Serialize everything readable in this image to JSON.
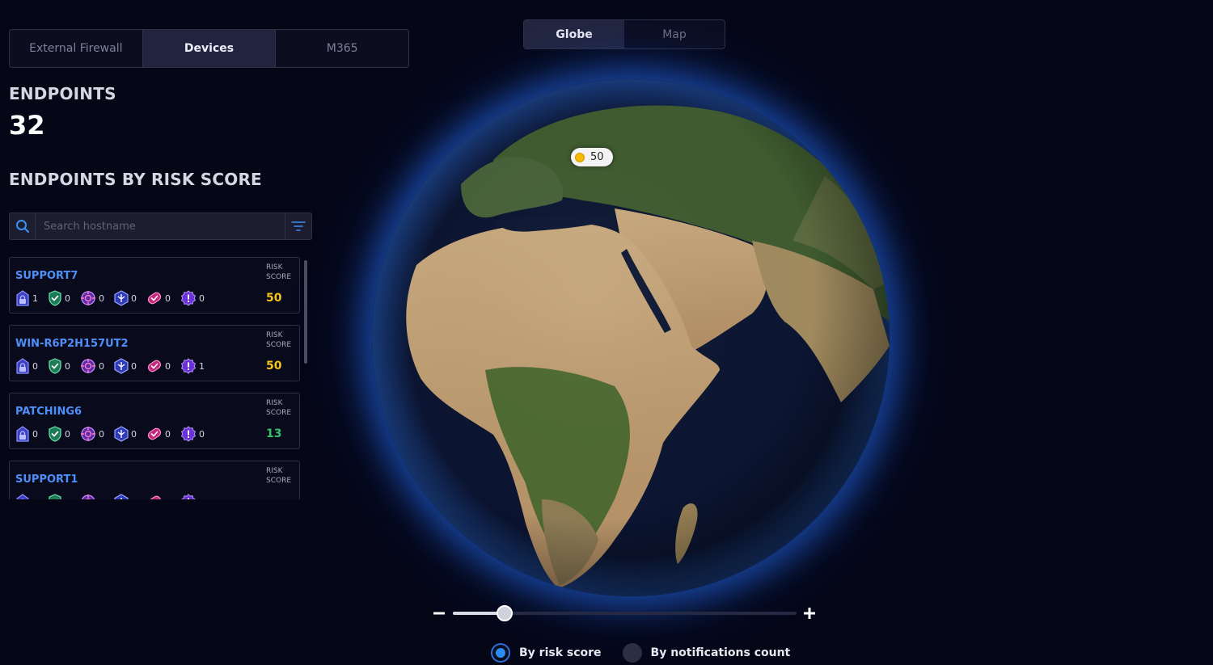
{
  "tabs": [
    {
      "label": "External Firewall",
      "active": false
    },
    {
      "label": "Devices",
      "active": true
    },
    {
      "label": "M365",
      "active": false
    }
  ],
  "endpoints": {
    "heading": "ENDPOINTS",
    "count": "32"
  },
  "risk_section": {
    "heading": "ENDPOINTS BY RISK SCORE"
  },
  "search": {
    "placeholder": "Search hostname",
    "value": ""
  },
  "list": {
    "risk_label": "RISK SCORE",
    "items": [
      {
        "hostname": "SUPPORT7",
        "metrics": [
          "1",
          "0",
          "0",
          "0",
          "0",
          "0"
        ],
        "risk_score": "50",
        "risk_color": "#f5c518"
      },
      {
        "hostname": "WIN-R6P2H157UT2",
        "metrics": [
          "0",
          "0",
          "0",
          "0",
          "0",
          "1"
        ],
        "risk_score": "50",
        "risk_color": "#f5c518"
      },
      {
        "hostname": "PATCHING6",
        "metrics": [
          "0",
          "0",
          "0",
          "0",
          "0",
          "0"
        ],
        "risk_score": "13",
        "risk_color": "#2fc36b"
      },
      {
        "hostname": "SUPPORT1",
        "metrics": [
          "",
          "",
          "",
          "",
          "",
          ""
        ],
        "risk_score": "",
        "risk_color": "#2fc36b"
      }
    ],
    "metric_icons": [
      "building-lock-icon",
      "shield-check-icon",
      "crosshair-icon",
      "hexagon-shield-icon",
      "patch-heart-icon",
      "alert-badge-icon"
    ]
  },
  "view_toggle": [
    {
      "label": "Globe",
      "active": true
    },
    {
      "label": "Map",
      "active": false
    }
  ],
  "globe_marker": {
    "value": "50",
    "color": "#f5b800"
  },
  "zoom": {
    "minus": "−",
    "plus": "+",
    "level": 0.15
  },
  "color_mode": [
    {
      "label": "By risk score",
      "selected": true
    },
    {
      "label": "By notifications count",
      "selected": false
    }
  ],
  "colors": {
    "accent": "#4f8ff7",
    "background": "#050717",
    "risk_high": "#f5c518",
    "risk_low": "#2fc36b"
  }
}
